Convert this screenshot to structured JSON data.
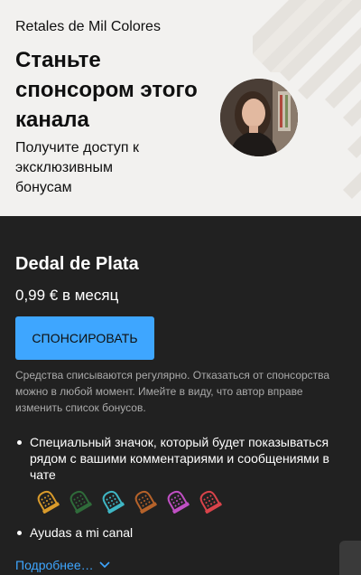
{
  "header": {
    "channel_name": "Retales de Mil Colores",
    "headline": "Станьте спонсором этого канала",
    "subline": "Получите доступ к эксклюзивным бонусам"
  },
  "tier": {
    "name": "Dedal de Plata",
    "price": "0,99 € в месяц",
    "sponsor_button": "СПОНСИРОВАТЬ",
    "disclaimer": "Средства списываются регулярно. Отказаться от спонсорства можно в любой момент. Имейте в виду, что автор вправе изменить список бонусов."
  },
  "benefits": [
    {
      "text": "Специальный значок, который будет показываться рядом с вашими комментариями и сообщениями в чате"
    },
    {
      "text": "Ayudas a mi canal"
    }
  ],
  "badges": [
    {
      "icon": "thimble-icon",
      "color": "#d89a2b"
    },
    {
      "icon": "thimble-icon",
      "color": "#2f6b3a"
    },
    {
      "icon": "thimble-icon",
      "color": "#3fb6c4"
    },
    {
      "icon": "thimble-icon",
      "color": "#b5622a"
    },
    {
      "icon": "thimble-icon",
      "color": "#c04fc4"
    },
    {
      "icon": "thimble-icon",
      "color": "#d9434a"
    }
  ],
  "more_link": "Подробнее…",
  "colors": {
    "accent": "#3ea6ff",
    "header_bg": "#f2f1ef",
    "content_bg": "#212121"
  }
}
